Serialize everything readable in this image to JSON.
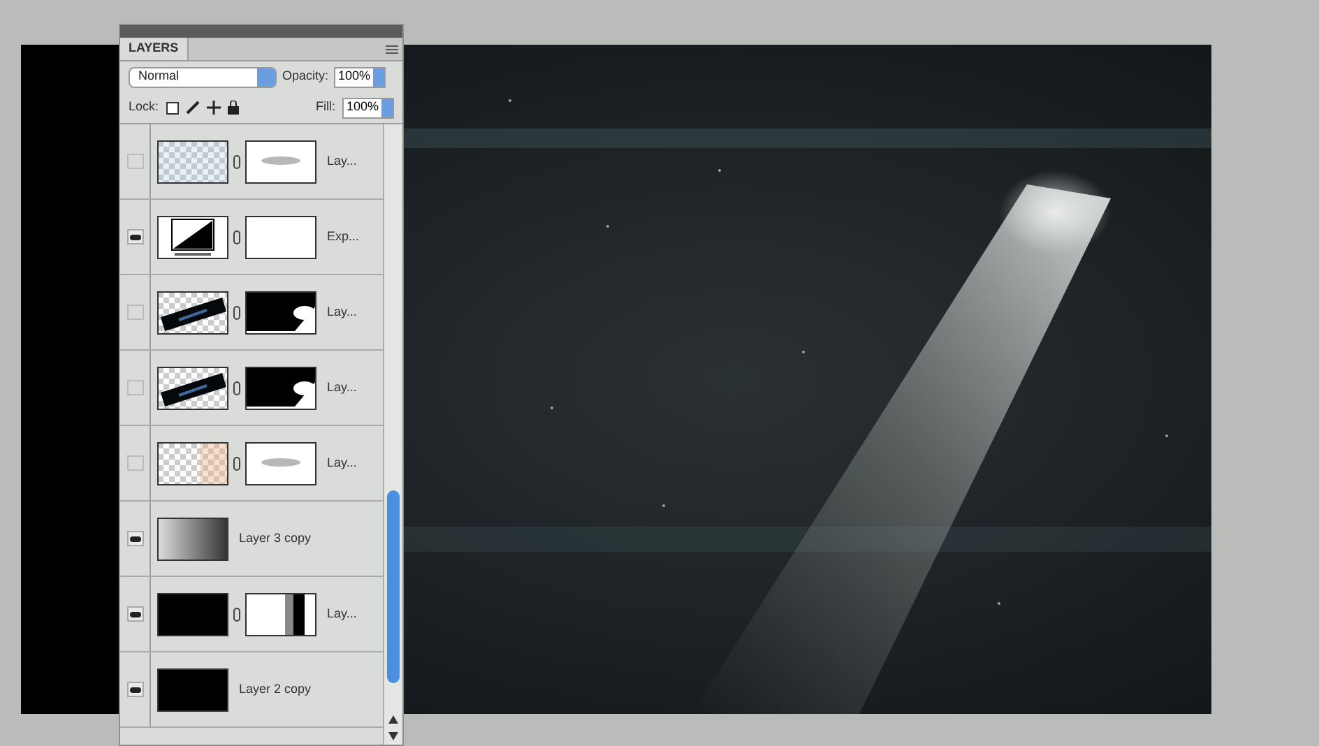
{
  "panel": {
    "tab": "LAYERS",
    "blend_mode": "Normal",
    "opacity_label": "Opacity:",
    "opacity": "100%",
    "lock_label": "Lock:",
    "fill_label": "Fill:",
    "fill": "100%"
  },
  "layers": [
    {
      "name": "Lay...",
      "visible": false,
      "kind": "checker"
    },
    {
      "name": "Exp...",
      "visible": true,
      "kind": "adjustment"
    },
    {
      "name": "Lay...",
      "visible": false,
      "kind": "bar"
    },
    {
      "name": "Lay...",
      "visible": false,
      "kind": "bar"
    },
    {
      "name": "Lay...",
      "visible": false,
      "kind": "peach"
    },
    {
      "name": "Layer 3 copy",
      "visible": true,
      "kind": "gradient"
    },
    {
      "name": "Lay...",
      "visible": true,
      "kind": "masked"
    },
    {
      "name": "Layer 2 copy",
      "visible": true,
      "kind": "fill"
    }
  ]
}
